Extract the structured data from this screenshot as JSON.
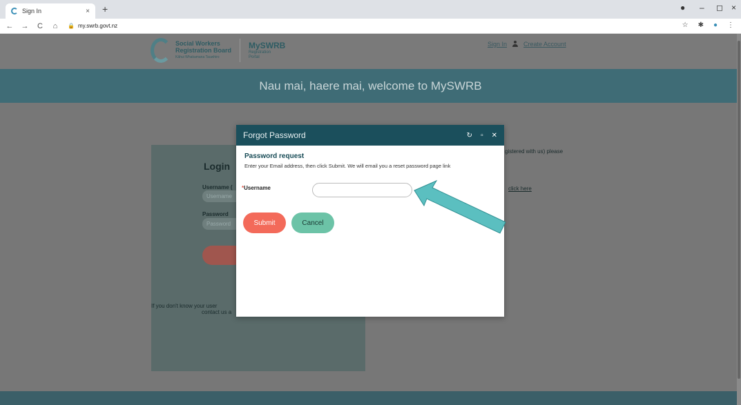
{
  "browser": {
    "tab_title": "Sign In",
    "tab_close": "×",
    "new_tab": "+",
    "url": "my.swrb.govt.nz",
    "window_controls": [
      "●",
      "–",
      "◻",
      "×"
    ]
  },
  "header": {
    "org_name_line1": "Social Workers",
    "org_name_line2": "Registration Board",
    "org_tagline": "Kāhui Whakamana Tauwhiro",
    "portal_name": "MySWRB",
    "portal_sub_line1": "Registration",
    "portal_sub_line2": "Portal",
    "sign_in_link": "Sign In",
    "create_account_link": "Create Account"
  },
  "banner": {
    "welcome": "Nau mai, haere mai, welcome to MySWRB"
  },
  "login": {
    "title": "Login",
    "username_label": "Username (",
    "username_placeholder": "Username",
    "password_label": "Password",
    "password_placeholder": "Password",
    "help_line1": "If you don't know your user",
    "help_line2": "contact us a",
    "right_text": "gistered with us) please",
    "right_link": "click here"
  },
  "modal": {
    "title": "Forgot Password",
    "request_title": "Password request",
    "request_desc": "Enter your Email address, then click Submit. We will email you a reset password page link",
    "required_mark": "*",
    "username_label": "Username",
    "username_value": "",
    "submit_label": "Submit",
    "cancel_label": "Cancel"
  },
  "colors": {
    "accent_teal": "#1b4f5c",
    "submit": "#f36a5a",
    "cancel": "#6cc3a7",
    "arrow": "#5bbfc0"
  }
}
